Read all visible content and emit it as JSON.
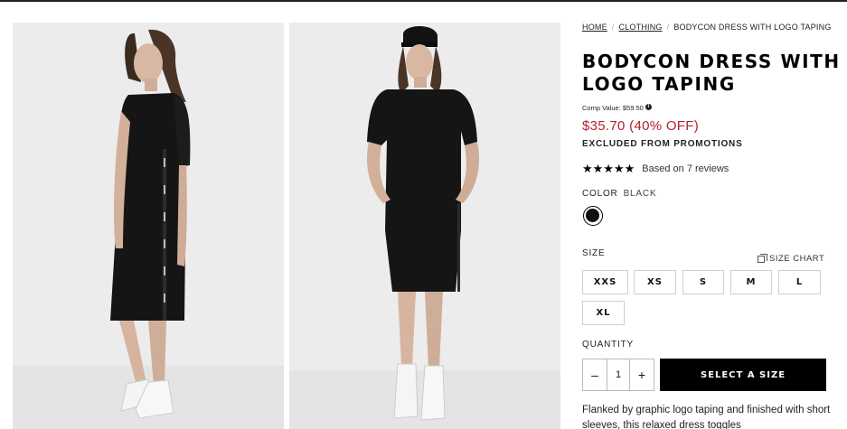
{
  "breadcrumb": {
    "items": [
      "HOME",
      "CLOTHING"
    ],
    "current": "BODYCON DRESS WITH LOGO TAPING"
  },
  "product": {
    "title": "BODYCON DRESS WITH LOGO TAPING",
    "comp_value": "Comp Value: $59.50",
    "price": "$35.70 (40% OFF)",
    "promotion_note": "EXCLUDED FROM PROMOTIONS",
    "rating": {
      "stars": "★★★★★",
      "value": 5,
      "text": "Based on 7 reviews"
    },
    "color": {
      "label": "COLOR",
      "value": "BLACK",
      "swatch": "#111111"
    },
    "size": {
      "label": "SIZE",
      "chart_link": "SIZE CHART",
      "options": [
        "XXS",
        "XS",
        "S",
        "M",
        "L",
        "XL"
      ]
    },
    "quantity": {
      "label": "QUANTITY",
      "minus": "–",
      "value": "1",
      "plus": "+"
    },
    "cta": "SELECT A SIZE",
    "description": "Flanked by graphic logo taping and finished with short sleeves, this relaxed dress toggles"
  },
  "gallery": {
    "images": [
      {
        "alt_icon": "model-side-view-image"
      },
      {
        "alt_icon": "model-front-view-image"
      }
    ]
  },
  "colors": {
    "price_red": "#b3202a",
    "cta_black": "#000000",
    "photo_bg": "#ececec"
  }
}
